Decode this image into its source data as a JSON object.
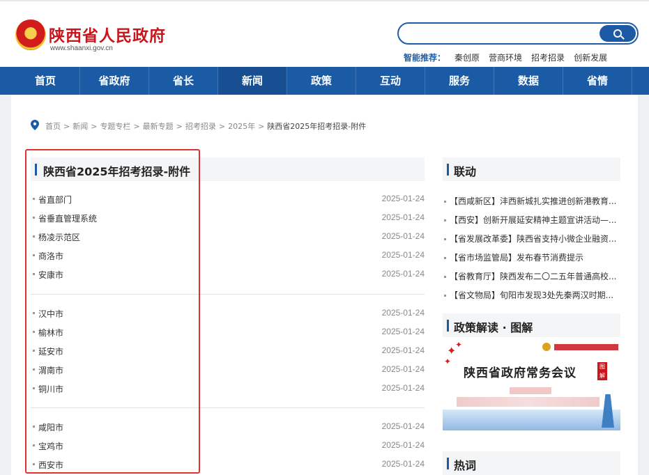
{
  "header": {
    "site_title": "陕西省人民政府",
    "site_url": "www.shaanxi.gov.cn",
    "search_placeholder": "",
    "recommend_label": "智能推荐：",
    "recommend_links": [
      "秦创原",
      "营商环境",
      "招考招录",
      "创新发展"
    ]
  },
  "nav": {
    "items": [
      "首页",
      "省政府",
      "省长",
      "新闻",
      "政策",
      "互动",
      "服务",
      "数据",
      "省情"
    ],
    "active_index": 3
  },
  "breadcrumb": {
    "items": [
      "首页",
      "新闻",
      "专题专栏",
      "最新专题",
      "招考招录",
      "2025年",
      "陕西省2025年招考招录-附件"
    ]
  },
  "main": {
    "title": "陕西省2025年招考招录-附件",
    "groups": [
      [
        {
          "name": "省直部门",
          "date": "2025-01-24"
        },
        {
          "name": "省垂直管理系统",
          "date": "2025-01-24"
        },
        {
          "name": "杨凌示范区",
          "date": "2025-01-24"
        },
        {
          "name": "商洛市",
          "date": "2025-01-24"
        },
        {
          "name": "安康市",
          "date": "2025-01-24"
        }
      ],
      [
        {
          "name": "汉中市",
          "date": "2025-01-24"
        },
        {
          "name": "榆林市",
          "date": "2025-01-24"
        },
        {
          "name": "延安市",
          "date": "2025-01-24"
        },
        {
          "name": "渭南市",
          "date": "2025-01-24"
        },
        {
          "name": "铜川市",
          "date": "2025-01-24"
        }
      ],
      [
        {
          "name": "咸阳市",
          "date": "2025-01-24"
        },
        {
          "name": "宝鸡市",
          "date": "2025-01-24"
        },
        {
          "name": "西安市",
          "date": "2025-01-24"
        }
      ]
    ]
  },
  "sidebar": {
    "linkage_title": "联动",
    "linkage_items": [
      "【西咸新区】沣西新城扎实推进创新港教育...",
      "【西安】创新开展延安精神主题宣讲活动—...",
      "【省发展改革委】陕西省支持小微企业融资...",
      "【省市场监管局】发布春节消费提示",
      "【省教育厅】陕西发布二〇二五年普通高校...",
      "【省文物局】旬阳市发现3处先秦两汉时期..."
    ],
    "policy_title": "政策解读 · 图解",
    "policy_image_text": "陕西省政府常务会议",
    "policy_image_tag": "图解",
    "hot_title": "热词"
  },
  "colors": {
    "brand_blue": "#1b5aa4",
    "brand_red": "#c8161d",
    "highlight_red": "#e03131"
  }
}
